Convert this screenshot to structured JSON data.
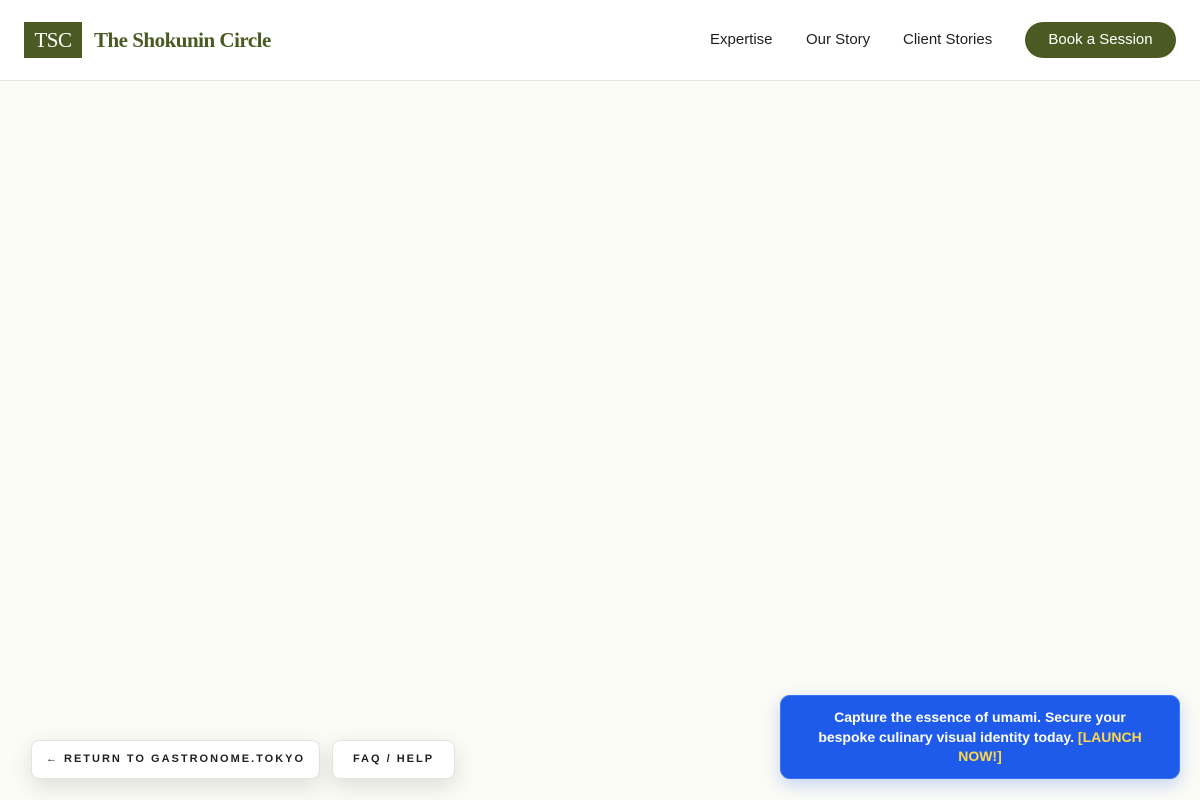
{
  "header": {
    "logo_mark": "TSC",
    "brand_name": "The Shokunin Circle",
    "nav": {
      "expertise": "Expertise",
      "our_story": "Our Story",
      "client_stories": "Client Stories"
    },
    "cta_label": "Book a Session"
  },
  "footer_actions": {
    "return_label": "← RETURN TO GASTRONOME.TOKYO",
    "faq_label": "FAQ / HELP"
  },
  "promo": {
    "message": "Capture the essence of umami. Secure your bespoke culinary visual identity today.",
    "cta": "[LAUNCH NOW!]"
  },
  "colors": {
    "brand": "#4a5a22",
    "page_background": "#fcfcf6",
    "promo_background": "#1f5bea",
    "promo_cta": "#ffd84a"
  }
}
